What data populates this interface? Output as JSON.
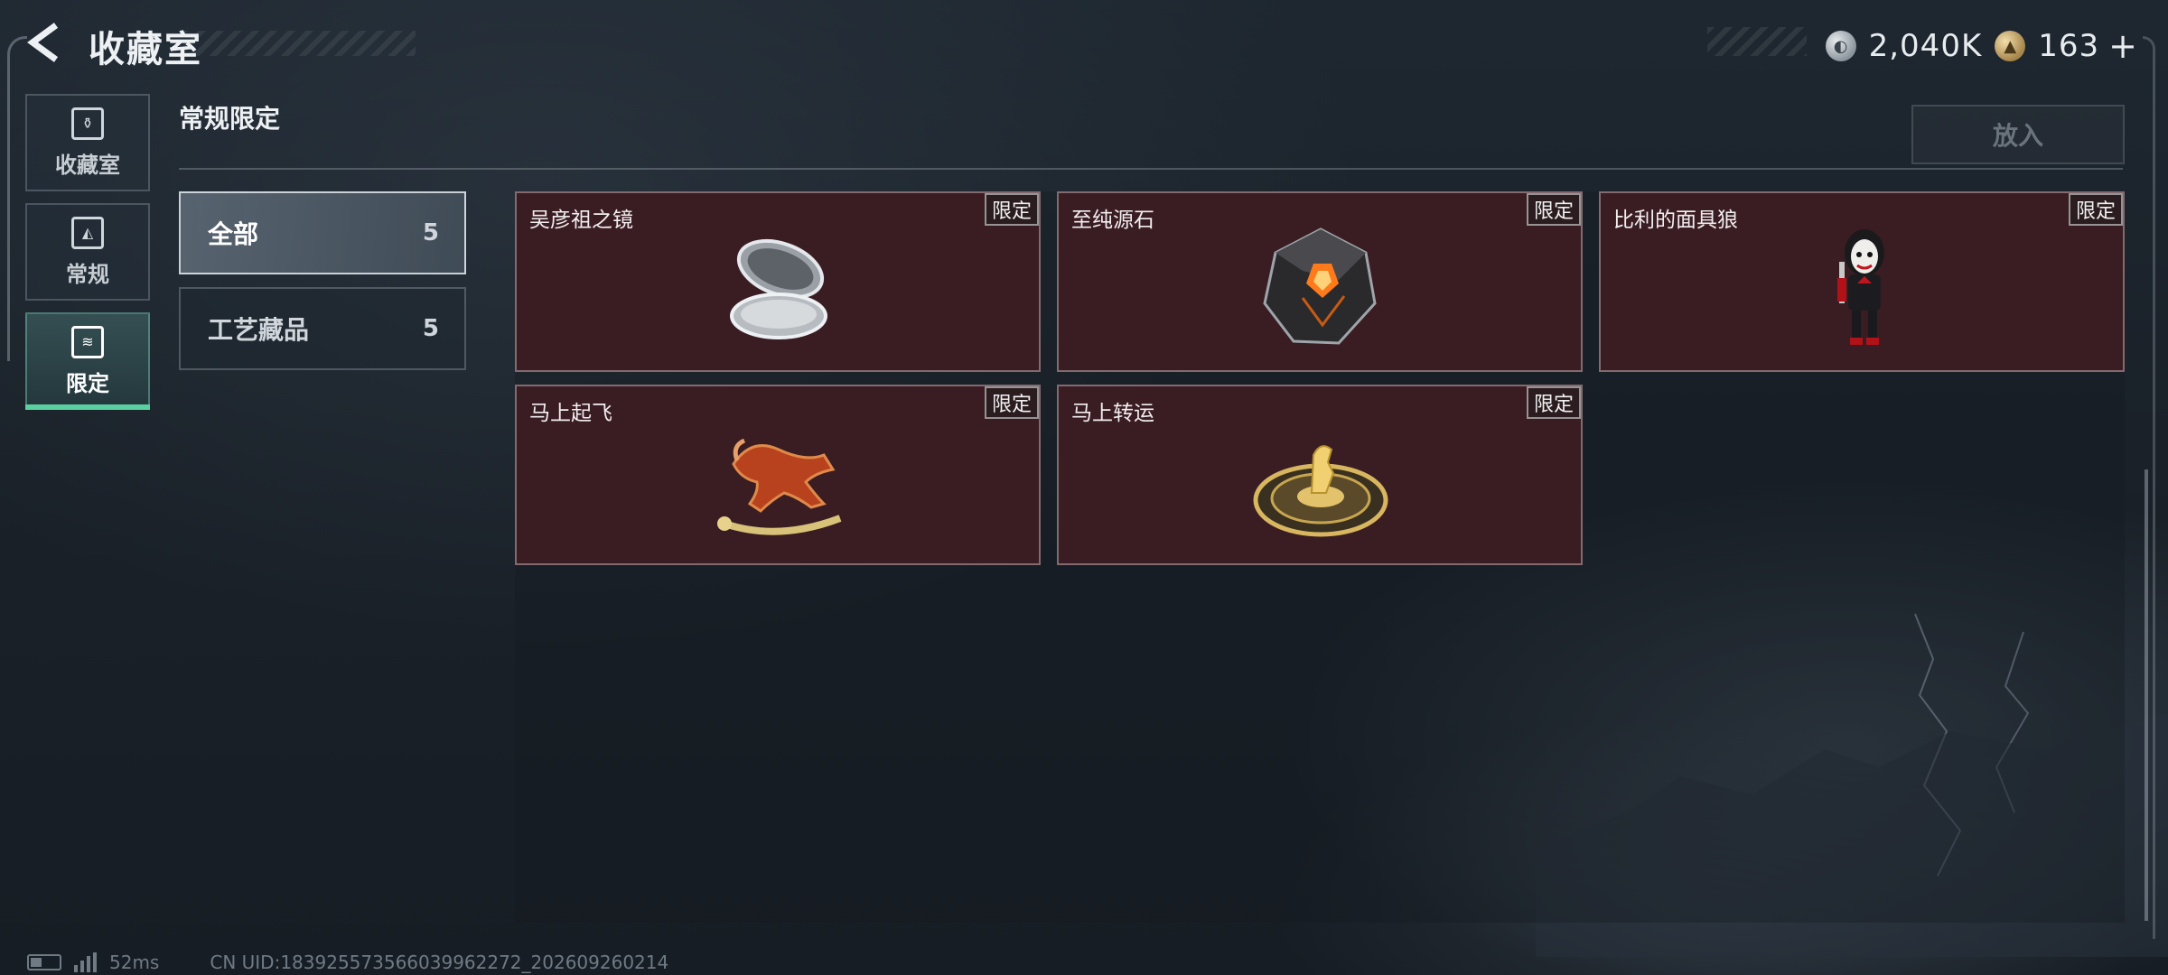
{
  "header": {
    "title": "收藏室",
    "currency": [
      {
        "icon": "silver-coin-icon",
        "value": "2,040K"
      },
      {
        "icon": "gold-coin-icon",
        "value": "163"
      }
    ],
    "plus_label": "+"
  },
  "side_nav": [
    {
      "label": "收藏室",
      "icon": "collection-room-icon",
      "active": false
    },
    {
      "label": "常规",
      "icon": "regular-icon",
      "active": false
    },
    {
      "label": "限定",
      "icon": "limited-icon",
      "active": true
    }
  ],
  "section": {
    "title": "常规限定",
    "place_button": "放入"
  },
  "categories": [
    {
      "label": "全部",
      "count": "5",
      "active": true
    },
    {
      "label": "工艺藏品",
      "count": "5",
      "active": false
    }
  ],
  "items": [
    {
      "name": "吴彦祖之镜",
      "badge": "限定",
      "art": "compact-mirror-icon"
    },
    {
      "name": "至纯源石",
      "badge": "限定",
      "art": "dark-crystal-icon"
    },
    {
      "name": "比利的面具狼",
      "badge": "限定",
      "art": "puppet-figure-icon"
    },
    {
      "name": "马上起飞",
      "badge": "限定",
      "art": "rocking-horse-icon"
    },
    {
      "name": "马上转运",
      "badge": "限定",
      "art": "horse-compass-icon"
    }
  ],
  "status": {
    "ping": "52ms",
    "uid": "CN UID:18392557356603996227​2_202609260214"
  },
  "colors": {
    "card_bg": "#3a1d22",
    "active_tab_accent": "#5ad0a0"
  }
}
